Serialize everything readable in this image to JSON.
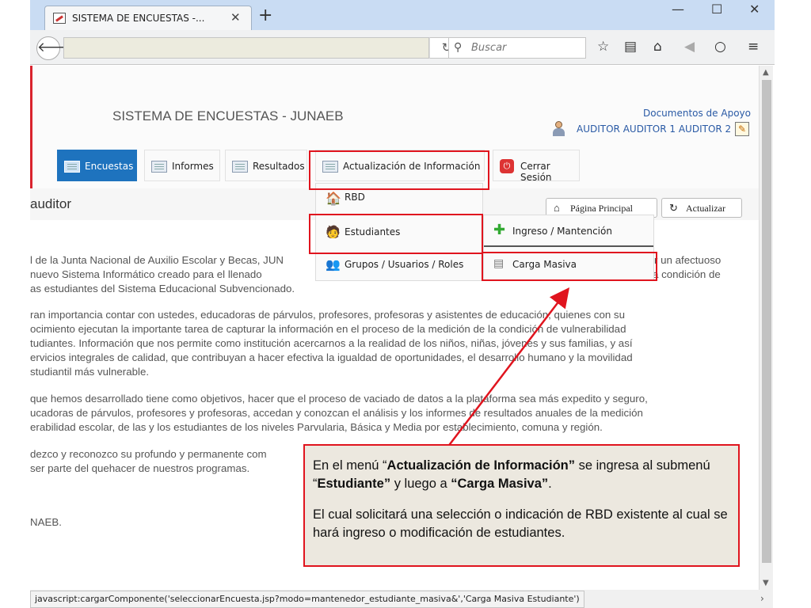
{
  "browser": {
    "tab_title": "SISTEMA DE ENCUESTAS -...",
    "search_placeholder": "Buscar",
    "status_text": "javascript:cargarComponente('seleccionarEncuesta.jsp?modo=mantenedor_estudiante_masiva&','Carga Masiva Estudiante')"
  },
  "header": {
    "site_title": "SISTEMA DE ENCUESTAS - JUNAEB",
    "doc_link": "Documentos de Apoyo",
    "user_name": "AUDITOR AUDITOR 1 AUDITOR 2"
  },
  "menu": {
    "items": [
      {
        "label": "Encuestas",
        "active": true
      },
      {
        "label": "Informes"
      },
      {
        "label": "Resultados"
      },
      {
        "label": "Actualización de Información"
      },
      {
        "label": "Cerrar Sesión"
      }
    ]
  },
  "dropdown": {
    "items": [
      "RBD",
      "Estudiantes",
      "Grupos / Usuarios / Roles"
    ],
    "submenu": [
      "Ingreso / Mantención",
      "Carga Masiva"
    ]
  },
  "section": {
    "title": "auditor",
    "page_button": "Página Principal",
    "refresh_button": "Actualizar"
  },
  "body_lines": [
    "l de la Junta Nacional de Auxilio Escolar y Becas, JUN",
    "r un afectuoso",
    " nuevo Sistema Informático creado para el llenado",
    "a condición de",
    "as estudiantes del Sistema Educacional Subvencionado.",
    "ran importancia contar con ustedes, educadoras de párvulos, profesores, profesoras y asistentes de educación, quienes con su",
    "ocimiento ejecutan la importante tarea de capturar la información en el proceso de la medición de la condición de vulnerabilidad",
    "tudiantes. Información que nos permite como institución acercarnos a la realidad de los niños, niñas, jóvenes y sus familias, y así",
    "ervicios integrales de calidad, que contribuyan a hacer efectiva la igualdad de oportunidades, el desarrollo humano y la movilidad",
    "studiantil más vulnerable.",
    "que hemos desarrollado tiene como objetivos, hacer que el proceso de vaciado de datos a la plataforma sea más expedito y seguro,",
    "ucadoras de párvulos, profesores y profesoras, accedan y conozcan el análisis y los informes de resultados anuales de la medición",
    "erabilidad escolar, de las y los estudiantes de los niveles Parvularia, Básica y Media por establecimiento, comuna y región.",
    "dezco y reconozco su profundo y permanente com",
    " ser parte del quehacer de nuestros programas.",
    "NAEB."
  ],
  "callout": {
    "p1_a": "En el menú  “",
    "p1_b": "Actualización de Información”",
    "p1_c": " se ingresa al submenú “",
    "p1_d": "Estudiante”",
    "p1_e": " y luego  a ",
    "p1_f": "“Carga Masiva”",
    "p1_g": ".",
    "p2": "El cual solicitará una selección o indicación de RBD existente al cual se hará ingreso o modificación de estudiantes."
  },
  "colors": {
    "accent": "#1e73be",
    "annotation": "#e0141e",
    "callout_bg": "#ece8df"
  }
}
